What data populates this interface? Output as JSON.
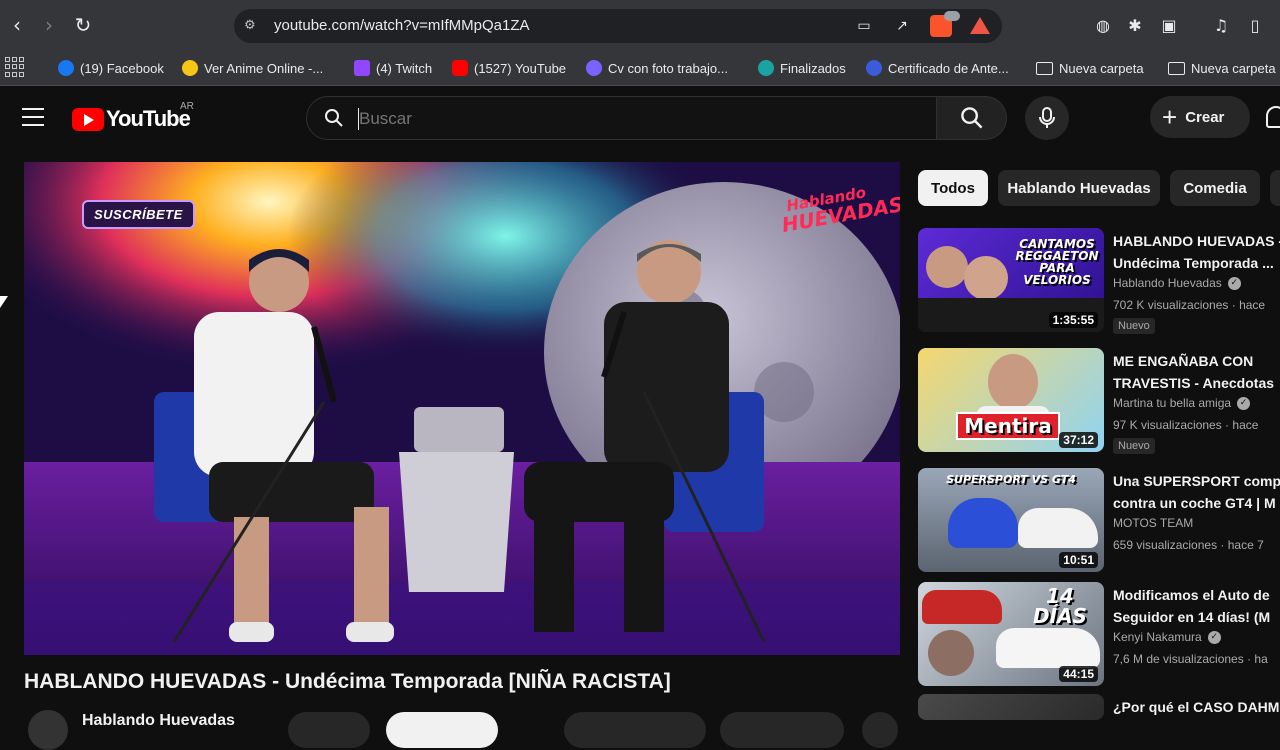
{
  "browser": {
    "url": "youtube.com/watch?v=mIfMMpQa1ZA",
    "bookmarks": [
      {
        "label": "(19) Facebook",
        "color": "#1877f2"
      },
      {
        "label": "Ver Anime Online -...",
        "color": "#f5c518"
      },
      {
        "label": "(4) Twitch",
        "color": "#9146ff"
      },
      {
        "label": "(1527) YouTube",
        "color": "#ff0000"
      },
      {
        "label": "Cv con foto trabajo...",
        "color": "#7b61ff"
      },
      {
        "label": "Finalizados",
        "color": "#1aa3a3"
      },
      {
        "label": "Certificado de Ante...",
        "color": "#3b5bdb"
      },
      {
        "label": "Nueva carpeta",
        "folder": true
      },
      {
        "label": "Nueva carpeta",
        "folder": true
      }
    ]
  },
  "yt": {
    "logo_text": "YouTube",
    "country": "AR",
    "search_placeholder": "Buscar",
    "create_label": "Crear"
  },
  "player": {
    "subscribe_badge": "SUSCRÍBETE",
    "show_logo_top": "Hablando",
    "show_logo_bottom": "HUEVADAS"
  },
  "video": {
    "title": "HABLANDO HUEVADAS - Undécima Temporada [NIÑA RACISTA]",
    "channel": "Hablando Huevadas"
  },
  "chips": [
    "Todos",
    "Hablando Huevadas",
    "Comedia"
  ],
  "recommendations": [
    {
      "title": "HABLANDO HUEVADAS -\nUndécima Temporada ...",
      "channel": "Hablando Huevadas",
      "verified": true,
      "meta": "702 K visualizaciones · hace",
      "badge": "Nuevo",
      "duration": "1:35:55",
      "caption": "CANTAMOS\nREGGAETON\nPARA\nVELORIOS"
    },
    {
      "title": "ME ENGAÑABA CON\nTRAVESTIS - Anecdotas",
      "channel": "Martina tu bella amiga",
      "verified": true,
      "meta": "97 K visualizaciones · hace",
      "badge": "Nuevo",
      "duration": "37:12",
      "caption": "Mentira"
    },
    {
      "title": "Una SUPERSPORT comp\ncontra un coche GT4 | M",
      "channel": "MOTOS TEAM",
      "verified": false,
      "meta": "659 visualizaciones · hace 7",
      "badge": "",
      "duration": "10:51",
      "caption": "SUPERSPORT VS GT4"
    },
    {
      "title": "Modificamos el Auto de\nSeguidor en 14 días! (M",
      "channel": "Kenyi Nakamura",
      "verified": true,
      "meta": "7,6 M de visualizaciones · ha",
      "badge": "",
      "duration": "44:15",
      "caption": "14 DÍAS"
    },
    {
      "title": "¿Por qué el CASO DAHM",
      "channel": "",
      "verified": false,
      "meta": "",
      "badge": "",
      "duration": "",
      "caption": ""
    }
  ],
  "colors": {
    "yt_red": "#ff0000",
    "background": "#0f0f0f",
    "chip_active_bg": "#f1f1f1",
    "chip_bg": "#272727"
  }
}
